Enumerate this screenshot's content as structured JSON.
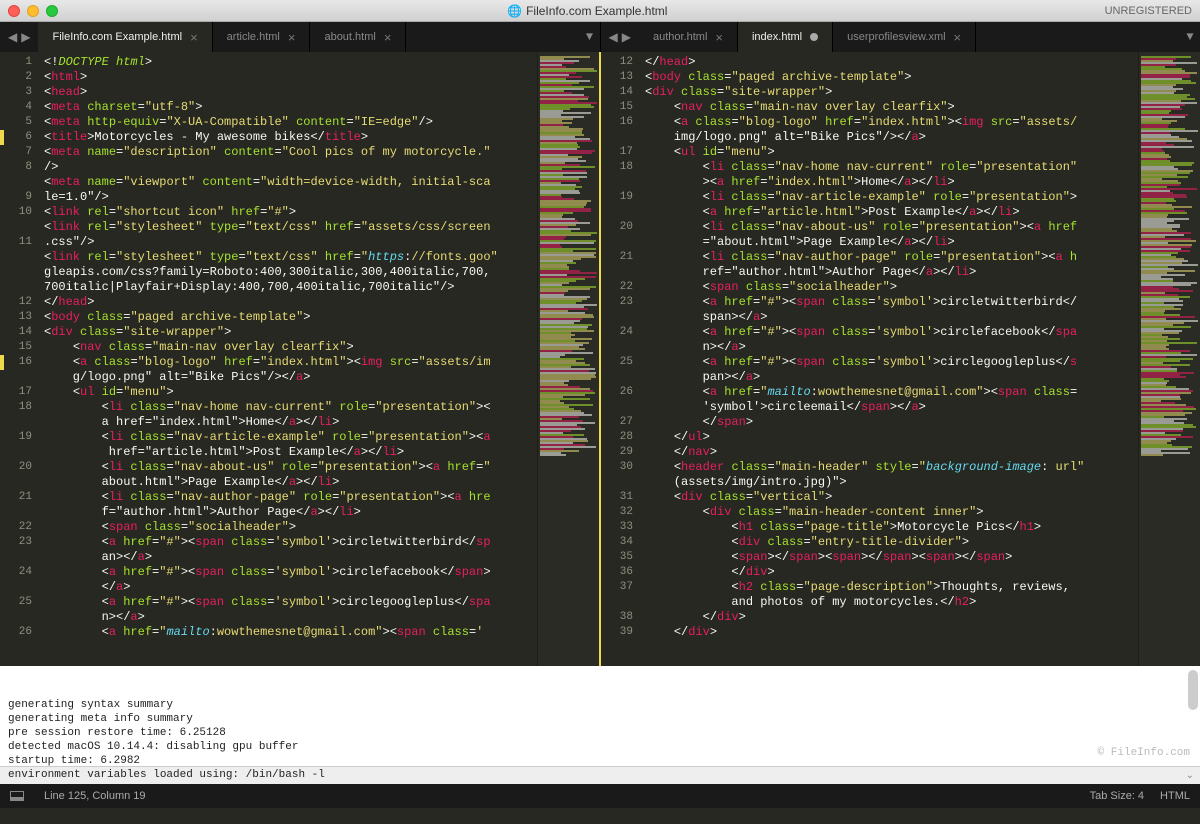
{
  "window": {
    "title": "FileInfo.com Example.html",
    "registration": "UNREGISTERED"
  },
  "tabs_left": [
    {
      "label": "FileInfo.com Example.html",
      "active": true,
      "close": "×"
    },
    {
      "label": "article.html",
      "active": false,
      "close": "×"
    },
    {
      "label": "about.html",
      "active": false,
      "close": "×"
    }
  ],
  "tabs_right": [
    {
      "label": "author.html",
      "active": false,
      "close": "×"
    },
    {
      "label": "index.html",
      "active": true,
      "unsaved": true
    },
    {
      "label": "userprofilesview.xml",
      "active": false,
      "close": "×"
    }
  ],
  "left_start_line": 1,
  "left_lines": [
    "<!DOCTYPE html>",
    "<html>",
    "<head>",
    "<meta charset=\"utf-8\">",
    "<meta http-equiv=\"X-UA-Compatible\" content=\"IE=edge\"/>",
    "<title>Motorcycles - My awesome bikes</title>",
    "<meta name=\"description\" content=\"Cool pics of my motorcycle.\"/>",
    "<meta name=\"viewport\" content=\"width=device-width, initial-scale=1.0\"/>",
    "<link rel=\"shortcut icon\" href=\"#\">",
    "<link rel=\"stylesheet\" type=\"text/css\" href=\"assets/css/screen.css\"/>",
    "<link rel=\"stylesheet\" type=\"text/css\" href=\"https://fonts.googleapis.com/css?family=Roboto:400,300italic,300,400italic,700,700italic|Playfair+Display:400,700,400italic,700italic\"/>",
    "</head>",
    "<body class=\"paged archive-template\">",
    "<div class=\"site-wrapper\">",
    "    <nav class=\"main-nav overlay clearfix\">",
    "    <a class=\"blog-logo\" href=\"index.html\"><img src=\"assets/img/logo.png\" alt=\"Bike Pics\"/></a>",
    "    <ul id=\"menu\">",
    "        <li class=\"nav-home nav-current\" role=\"presentation\"><a href=\"index.html\">Home</a></li>",
    "        <li class=\"nav-article-example\" role=\"presentation\"><a href=\"article.html\">Post Example</a></li>",
    "        <li class=\"nav-about-us\" role=\"presentation\"><a href=\"about.html\">Page Example</a></li>",
    "        <li class=\"nav-author-page\" role=\"presentation\"><a href=\"author.html\">Author Page</a></li>",
    "        <span class=\"socialheader\">",
    "        <a href=\"#\"><span class='symbol'>circletwitterbird</span></a>",
    "        <a href=\"#\"><span class='symbol'>circlefacebook</span></a>",
    "        <a href=\"#\"><span class='symbol'>circlegoogleplus</span></a>",
    "        <a href=\"mailto:wowthemesnet@gmail.com\"><span class='"
  ],
  "left_line_numbers": [
    "1",
    "2",
    "3",
    "4",
    "5",
    "6",
    "7",
    "8",
    "",
    "9",
    "10",
    "",
    "11",
    "",
    "",
    "",
    "12",
    "13",
    "14",
    "15",
    "16",
    "",
    "17",
    "18",
    "",
    "19",
    "",
    "20",
    "",
    "21",
    "",
    "22",
    "23",
    "",
    "24",
    "",
    "25",
    "",
    "26"
  ],
  "left_mod_lines": [
    6,
    16
  ],
  "right_start_line": 12,
  "right_lines": [
    "</head>",
    "<body class=\"paged archive-template\">",
    "<div class=\"site-wrapper\">",
    "    <nav class=\"main-nav overlay clearfix\">",
    "    <a class=\"blog-logo\" href=\"index.html\"><img src=\"assets/img/logo.png\" alt=\"Bike Pics\"/></a>",
    "    <ul id=\"menu\">",
    "        <li class=\"nav-home nav-current\" role=\"presentation\"><a href=\"index.html\">Home</a></li>",
    "        <li class=\"nav-article-example\" role=\"presentation\"><a href=\"article.html\">Post Example</a></li>",
    "        <li class=\"nav-about-us\" role=\"presentation\"><a href=\"about.html\">Page Example</a></li>",
    "        <li class=\"nav-author-page\" role=\"presentation\"><a href=\"author.html\">Author Page</a></li>",
    "        <span class=\"socialheader\">",
    "        <a href=\"#\"><span class='symbol'>circletwitterbird</span></a>",
    "        <a href=\"#\"><span class='symbol'>circlefacebook</span></a>",
    "        <a href=\"#\"><span class='symbol'>circlegoogleplus</span></a>",
    "        <a href=\"mailto:wowthemesnet@gmail.com\"><span class='symbol'>circleemail</span></a>",
    "        </span>",
    "    </ul>",
    "    </nav>",
    "    <header class=\"main-header\" style=\"background-image: url(assets/img/intro.jpg)\">",
    "    <div class=\"vertical\">",
    "        <div class=\"main-header-content inner\">",
    "            <h1 class=\"page-title\">Motorcycle Pics</h1>",
    "            <div class=\"entry-title-divider\">",
    "            <span></span><span></span><span></span>",
    "            </div>",
    "            <h2 class=\"page-description\">Thoughts, reviews, and photos of my motorcycles.</h2>",
    "        </div>",
    "    </div>"
  ],
  "right_line_numbers": [
    "12",
    "13",
    "14",
    "15",
    "16",
    "",
    "17",
    "18",
    "",
    "19",
    "",
    "20",
    "",
    "21",
    "",
    "22",
    "23",
    "",
    "24",
    "",
    "25",
    "",
    "26",
    "",
    "27",
    "28",
    "29",
    "30",
    "",
    "31",
    "32",
    "33",
    "34",
    "35",
    "36",
    "37",
    "",
    "38",
    "39"
  ],
  "console_lines": [
    "generating syntax summary",
    "generating meta info summary",
    "pre session restore time: 6.25128",
    "detected macOS 10.14.4: disabling gpu buffer",
    "startup time: 6.2982",
    "environment variables loaded using: /bin/bash -l"
  ],
  "watermark": "© FileInfo.com",
  "status": {
    "cursor": "Line 125, Column 19",
    "tabsize": "Tab Size: 4",
    "lang": "HTML"
  }
}
